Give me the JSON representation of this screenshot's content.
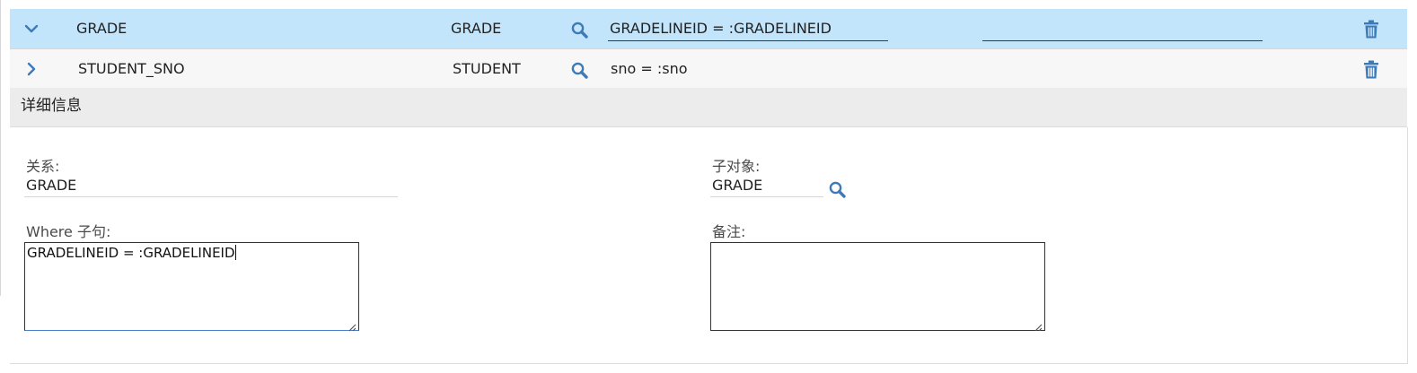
{
  "rows": [
    {
      "name": "GRADE",
      "child_object": "GRADE",
      "where_clause": "GRADELINEID = :GRADELINEID",
      "expanded": true
    },
    {
      "name": "STUDENT_SNO",
      "child_object": "STUDENT",
      "where_clause": "sno = :sno",
      "expanded": false
    }
  ],
  "details": {
    "header": "详细信息",
    "relationship_label": "关系:",
    "relationship_value": "GRADE",
    "child_object_label": "子对象:",
    "child_object_value": "GRADE",
    "where_label": "Where 子句:",
    "where_value": "GRADELINEID = :GRADELINEID",
    "remarks_label": "备注:",
    "remarks_value": ""
  },
  "colors": {
    "selected_row": "#c3e5fb",
    "icon_blue": "#3d7ab8",
    "details_header": "#ececec"
  },
  "icons": {
    "expanded": "chevron-down-icon",
    "collapsed": "chevron-right-icon",
    "lookup": "magnifier-icon",
    "delete": "trash-icon",
    "resize": "resize-grip-icon"
  }
}
